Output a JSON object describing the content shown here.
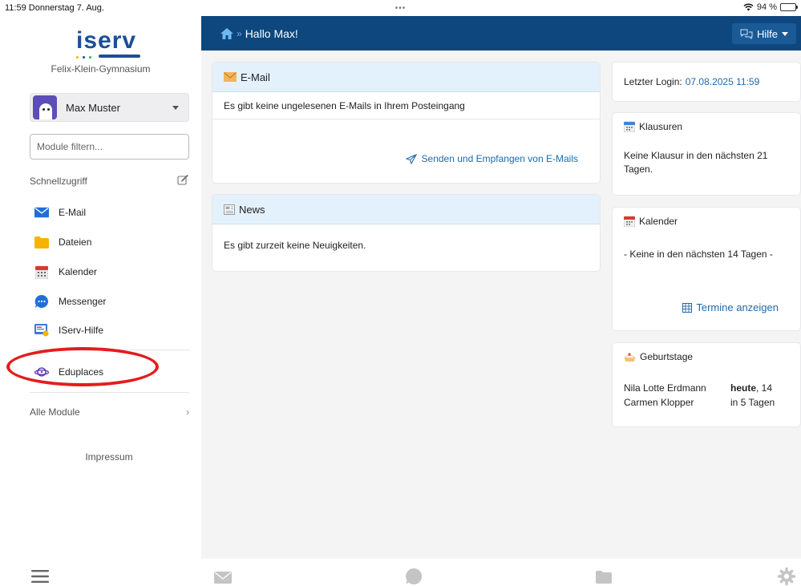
{
  "status": {
    "time_date": "11:59  Donnerstag 7. Aug.",
    "dots": "•••",
    "battery": "94 %",
    "battery_level": 0.94
  },
  "sidebar": {
    "logo": "iserv",
    "school": "Felix-Klein-Gymnasium",
    "user": "Max Muster",
    "filter_placeholder": "Module filtern...",
    "quick_title": "Schnellzugriff",
    "items": [
      {
        "label": "E-Mail",
        "icon": "mail-icon"
      },
      {
        "label": "Dateien",
        "icon": "folder-icon"
      },
      {
        "label": "Kalender",
        "icon": "calendar-icon"
      },
      {
        "label": "Messenger",
        "icon": "messenger-icon"
      },
      {
        "label": "IServ-Hilfe",
        "icon": "help-icon"
      }
    ],
    "extra_item": {
      "label": "Eduplaces",
      "icon": "planet-icon"
    },
    "all_modules": "Alle Module",
    "all_modules_chevron": "›",
    "impressum": "Impressum"
  },
  "header": {
    "crumb_sep": "»",
    "greeting": "Hallo Max!",
    "help": "Hilfe"
  },
  "mail_card": {
    "title": "E-Mail",
    "message": "Es gibt keine ungelesenen E-Mails in Ihrem Posteingang",
    "link": "Senden und Empfangen von E-Mails"
  },
  "news_card": {
    "title": "News",
    "message": "Es gibt zurzeit keine Neuigkeiten."
  },
  "login_card": {
    "label": "Letzter Login:",
    "value": "07.08.2025 11:59"
  },
  "exams_card": {
    "title": "Klausuren",
    "message": "Keine Klausur in den nächsten 21 Tagen."
  },
  "calendar_card": {
    "title": "Kalender",
    "message": "- Keine in den nächsten 14 Tagen -",
    "link": "Termine anzeigen"
  },
  "birthdays_card": {
    "title": "Geburtstage",
    "rows": [
      {
        "name": "Nila Lotte Erdmann",
        "when_bold": "heute",
        "when_rest": ", 14"
      },
      {
        "name": "Carmen Klopper",
        "when_bold": "",
        "when_rest": "in 5 Tagen"
      }
    ]
  },
  "colors": {
    "header": "#0d477d",
    "accent": "#1e6aad",
    "card_head": "#e2f1fb",
    "highlight": "#e31d1d"
  }
}
